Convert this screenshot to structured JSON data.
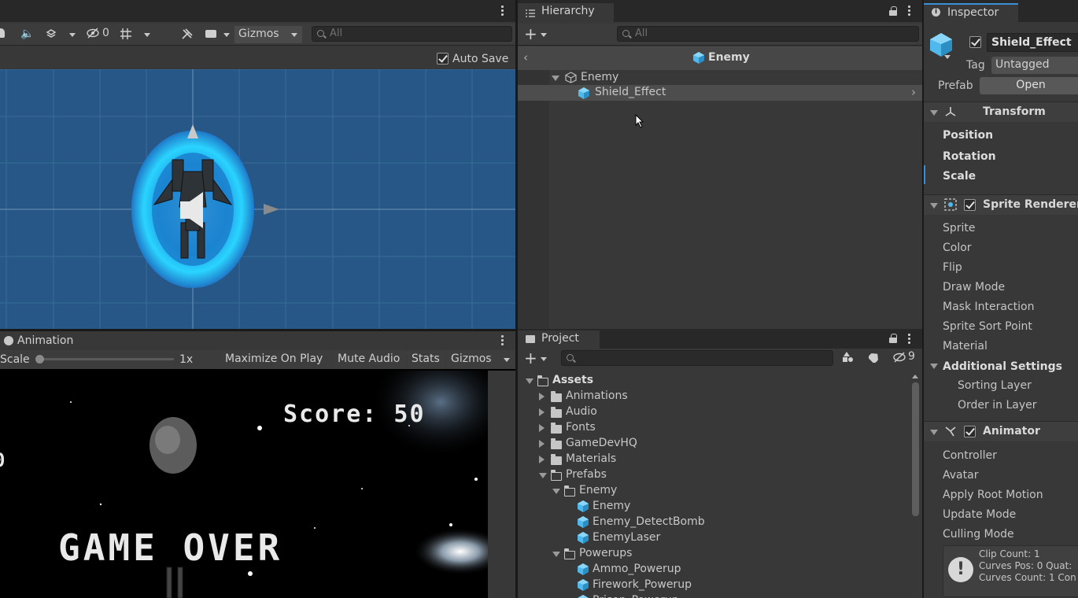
{
  "scene": {
    "toolbar": {
      "hidden_count": "0",
      "gizmos_label": "Gizmos",
      "search_placeholder": "All"
    },
    "auto_save_label": "Auto Save"
  },
  "hierarchy": {
    "tab_label": "Hierarchy",
    "search_placeholder": "All",
    "breadcrumb": "Enemy",
    "items": [
      {
        "label": "Enemy"
      },
      {
        "label": "Shield_Effect"
      }
    ]
  },
  "inspector": {
    "tab_label": "Inspector",
    "object_name": "Shield_Effect",
    "tag_label": "Tag",
    "tag_value": "Untagged",
    "prefab_label": "Prefab",
    "open_button": "Open",
    "transform": {
      "title": "Transform",
      "fields": [
        "Position",
        "Rotation",
        "Scale"
      ]
    },
    "sprite_renderer": {
      "title": "Sprite Renderer",
      "fields": [
        "Sprite",
        "Color",
        "Flip",
        "Draw Mode",
        "Mask Interaction",
        "Sprite Sort Point",
        "Material"
      ],
      "additional_settings": "Additional Settings",
      "sub_fields": [
        "Sorting Layer",
        "Order in Layer"
      ]
    },
    "animator": {
      "title": "Animator",
      "fields": [
        "Controller",
        "Avatar",
        "Apply Root Motion",
        "Update Mode",
        "Culling Mode"
      ],
      "info_lines": [
        "Clip Count: 1",
        "Curves Pos: 0 Quat:",
        "Curves Count: 1 Con"
      ]
    }
  },
  "animation": {
    "tab_label": "Animation",
    "scale_label": "Scale",
    "scale_value": "1x",
    "buttons": [
      "Maximize On Play",
      "Mute Audio",
      "Stats",
      "Gizmos"
    ]
  },
  "game": {
    "score_text": "Score: 50",
    "left_partial": "0",
    "game_over_text": "GAME OVER"
  },
  "project": {
    "tab_label": "Project",
    "hidden_count": "9",
    "tree": [
      {
        "label": "Assets",
        "kind": "folder-open",
        "depth": 0
      },
      {
        "label": "Animations",
        "kind": "folder",
        "depth": 1
      },
      {
        "label": "Audio",
        "kind": "folder",
        "depth": 1
      },
      {
        "label": "Fonts",
        "kind": "folder",
        "depth": 1
      },
      {
        "label": "GameDevHQ",
        "kind": "folder",
        "depth": 1
      },
      {
        "label": "Materials",
        "kind": "folder",
        "depth": 1
      },
      {
        "label": "Prefabs",
        "kind": "folder-open",
        "depth": 1
      },
      {
        "label": "Enemy",
        "kind": "folder-open",
        "depth": 2
      },
      {
        "label": "Enemy",
        "kind": "prefab",
        "depth": 3
      },
      {
        "label": "Enemy_DetectBomb",
        "kind": "prefab",
        "depth": 3
      },
      {
        "label": "EnemyLaser",
        "kind": "prefab",
        "depth": 3
      },
      {
        "label": "Powerups",
        "kind": "folder-open",
        "depth": 2
      },
      {
        "label": "Ammo_Powerup",
        "kind": "prefab",
        "depth": 3
      },
      {
        "label": "Firework_Powerup",
        "kind": "prefab",
        "depth": 3
      },
      {
        "label": "Prison_Powerup",
        "kind": "prefab",
        "depth": 3
      }
    ]
  },
  "colors": {
    "accent_blue": "#3a8fd6",
    "prefab_blue": "#4fb8ec",
    "scene_bg": "#265786",
    "panel_bg": "#383838"
  }
}
